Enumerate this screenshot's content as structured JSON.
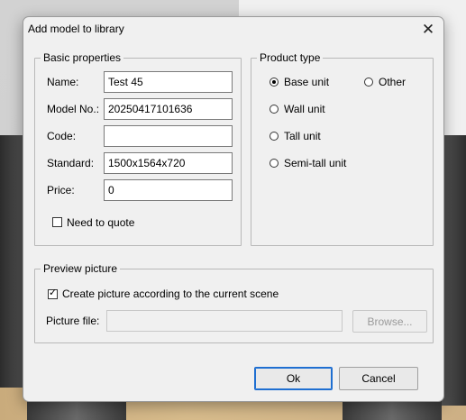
{
  "dialog": {
    "title": "Add model to library"
  },
  "basic": {
    "legend": "Basic properties",
    "name_label": "Name:",
    "name_value": "Test 45",
    "model_label": "Model No.:",
    "model_value": "20250417101636",
    "code_label": "Code:",
    "code_value": "",
    "standard_label": "Standard:",
    "standard_value": "1500x1564x720",
    "price_label": "Price:",
    "price_value": "0",
    "quote_label": "Need to quote",
    "quote_checked": false
  },
  "product_type": {
    "legend": "Product type",
    "options": [
      {
        "label": "Base unit",
        "selected": true
      },
      {
        "label": "Other",
        "selected": false
      },
      {
        "label": "Wall unit",
        "selected": false
      },
      {
        "label": "Tall unit",
        "selected": false
      },
      {
        "label": "Semi-tall unit",
        "selected": false
      }
    ]
  },
  "preview": {
    "legend": "Preview picture",
    "create_label": "Create picture according to the current scene",
    "create_checked": true,
    "file_label": "Picture file:",
    "file_value": "",
    "browse_label": "Browse..."
  },
  "buttons": {
    "ok": "Ok",
    "cancel": "Cancel"
  },
  "glyphs": {
    "close": "✕",
    "check": "✓"
  }
}
